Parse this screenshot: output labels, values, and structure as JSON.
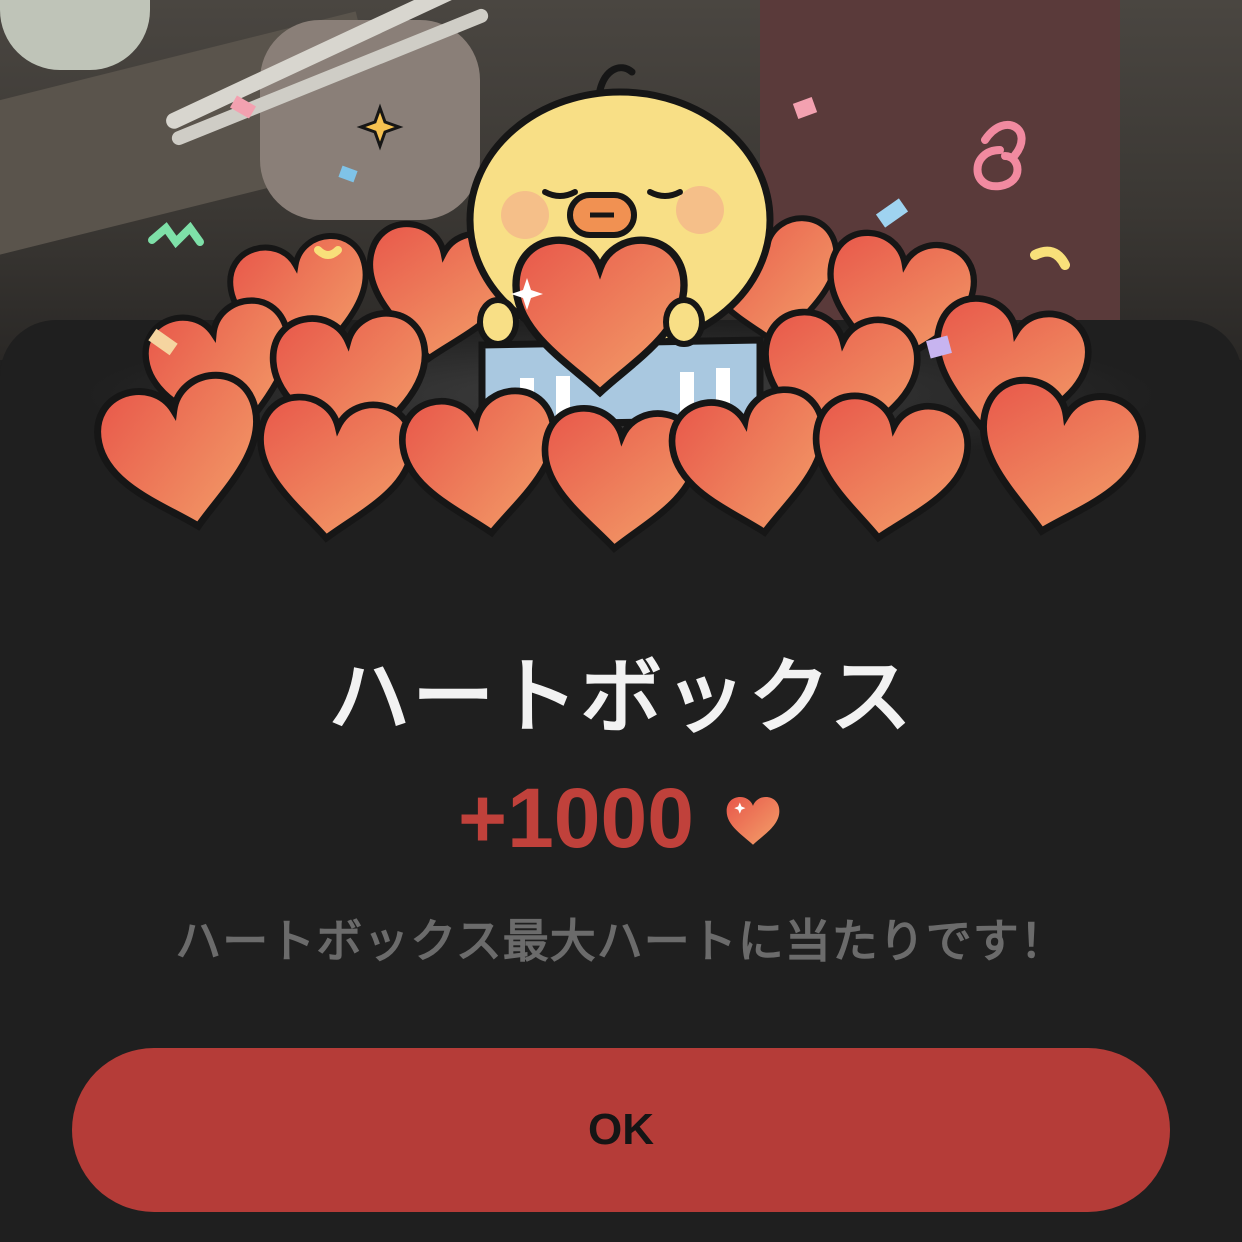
{
  "dialog": {
    "title": "ハートボックス",
    "amount": "+1000",
    "description": "ハートボックス最大ハートに当たりです！",
    "ok_label": "OK"
  },
  "icons": {
    "amount_icon": "heart-icon",
    "illustration": "chick-holding-heart-illustration"
  },
  "colors": {
    "accent": "#b53c38",
    "amount_text": "#c0413b",
    "sheet_bg": "#1f1f1f",
    "title_text": "#f2f2f2",
    "description_text": "#6b6b6b"
  }
}
